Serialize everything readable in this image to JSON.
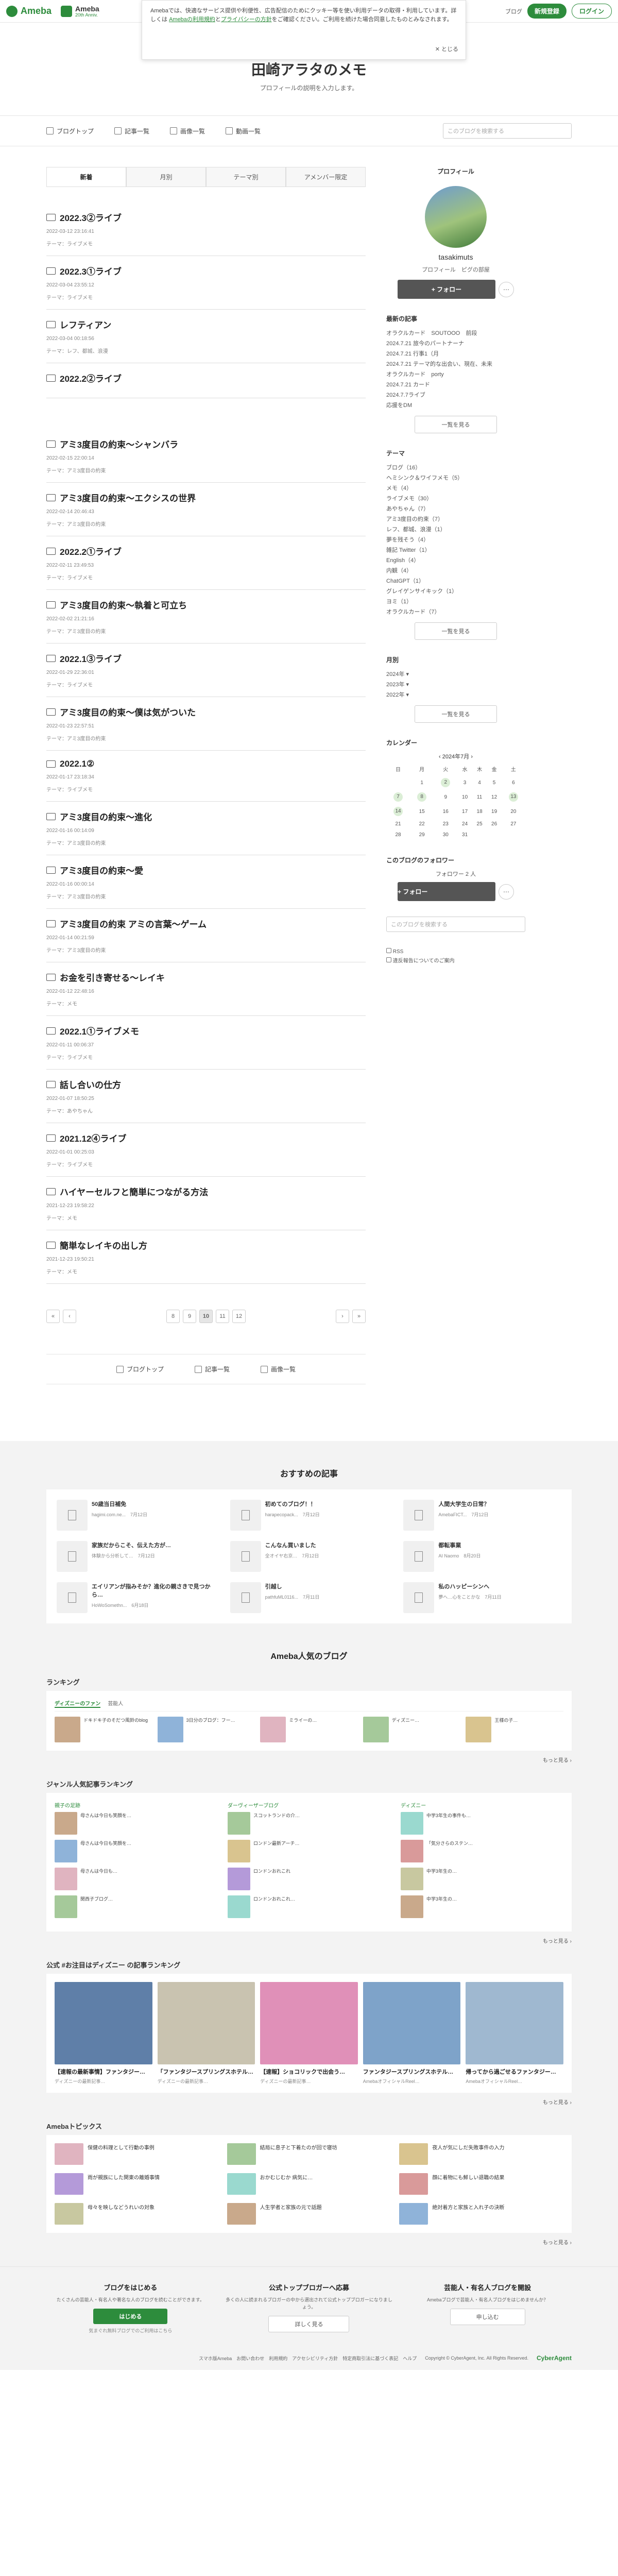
{
  "header": {
    "brand": "Ameba",
    "sub_brand_top": "Ameba",
    "sub_brand_bottom": "20th Anniv.",
    "blog_link": "ブログ",
    "register": "新規登録",
    "login": "ログイン"
  },
  "cookie_notice": {
    "text": "Amebaでは、快適なサービス提供や利便性、広告配信のためにクッキー等を使い利用データの取得・利用しています。詳しくは",
    "link1": "Amebaの利用規約",
    "mid": "と",
    "link2": "プライバシーの方針",
    "tail": "をご確認ください。ご利用を続けた場合同意したものとみなされます。",
    "close": "とじる"
  },
  "blog": {
    "title": "田崎アラタのメモ",
    "description": "プロフィールの説明を入力します。"
  },
  "nav": {
    "items": [
      "ブログトップ",
      "記事一覧",
      "画像一覧",
      "動画一覧"
    ],
    "search_placeholder": "このブログを検索する"
  },
  "tabs": [
    "新着",
    "月別",
    "テーマ別",
    "アメンバー限定"
  ],
  "entries": [
    {
      "title": "2022.3②ライブ",
      "date": "2022-03-12 23:16:41",
      "theme": "テーマ：ライブメモ"
    },
    {
      "title": "2022.3①ライブ",
      "date": "2022-03-04 23:55:12",
      "theme": "テーマ：ライブメモ"
    },
    {
      "title": "レフティアン",
      "date": "2022-03-04 00:18:56",
      "theme": "テーマ：レフ、都城、浪漫"
    },
    {
      "title": "2022.2②ライブ",
      "date": "",
      "theme": ""
    }
  ],
  "entries2": [
    {
      "title": "アミ3度目の約束〜シャンバラ",
      "date": "2022-02-15 22:00:14",
      "theme": "テーマ：アミ3度目の約束"
    },
    {
      "title": "アミ3度目の約束〜エクシスの世界",
      "date": "2022-02-14 20:46:43",
      "theme": "テーマ：アミ3度目の約束"
    },
    {
      "title": "2022.2①ライブ",
      "date": "2022-02-11 23:49:53",
      "theme": "テーマ：ライブメモ"
    },
    {
      "title": "アミ3度目の約束〜執着と可立ち",
      "date": "2022-02-02 21:21:16",
      "theme": "テーマ：アミ3度目の約束"
    },
    {
      "title": "2022.1③ライブ",
      "date": "2022-01-29 22:36:01",
      "theme": "テーマ：ライブメモ"
    },
    {
      "title": "アミ3度目の約束〜僕は気がついた",
      "date": "2022-01-23 22:57:51",
      "theme": "テーマ：アミ3度目の約束"
    },
    {
      "title": "2022.1②",
      "date": "2022-01-17 23:18:34",
      "theme": "テーマ：ライブメモ"
    },
    {
      "title": "アミ3度目の約束〜進化",
      "date": "2022-01-16 00:14:09",
      "theme": "テーマ：アミ3度目の約束"
    },
    {
      "title": "アミ3度目の約束〜愛",
      "date": "2022-01-16 00:00:14",
      "theme": "テーマ：アミ3度目の約束"
    },
    {
      "title": "アミ3度目の約束 アミの言葉〜ゲーム",
      "date": "2022-01-14 00:21:59",
      "theme": "テーマ：アミ3度目の約束"
    },
    {
      "title": "お金を引き寄せる〜レイキ",
      "date": "2022-01-12 22:48:16",
      "theme": "テーマ：メモ"
    },
    {
      "title": "2022.1①ライブメモ",
      "date": "2022-01-11 00:06:37",
      "theme": "テーマ：ライブメモ"
    },
    {
      "title": "話し合いの仕方",
      "date": "2022-01-07 18:50:25",
      "theme": "テーマ：あやちゃん"
    },
    {
      "title": "2021.12④ライブ",
      "date": "2022-01-01 00:25:03",
      "theme": "テーマ：ライブメモ"
    },
    {
      "title": "ハイヤーセルフと簡単につながる方法",
      "date": "2021-12-23 19:58:22",
      "theme": "テーマ：メモ"
    },
    {
      "title": "簡単なレイキの出し方",
      "date": "2021-12-23 19:50:21",
      "theme": "テーマ：メモ"
    }
  ],
  "pager": [
    "8",
    "9",
    "10",
    "11",
    "12"
  ],
  "pager_current": "10",
  "bottom_nav": [
    "ブログトップ",
    "記事一覧",
    "画像一覧"
  ],
  "sidebar": {
    "profile_heading": "プロフィール",
    "name": "tasakimuts",
    "sub": "プロフィール　ピグの部屋",
    "follow": "フォロー",
    "recent_heading": "最新の記事",
    "recent": [
      "オラクルカード　SOUTOOO　前段",
      "2024.7.21 旅今のパートナーナ",
      "2024.7.21 行事1（月",
      "2024.7.21 テーマ的な出会い、現在、未来",
      "オラクルカード　porty",
      "2024.7.21 カード",
      "2024.7.7ライブ",
      "応援をDM"
    ],
    "recent_more": "一覧を見る",
    "theme_heading": "テーマ",
    "themes": [
      "ブログ（16）",
      "ヘミシンク＆ワイフメモ（5）",
      "メモ（4）",
      "ライブメモ（30）",
      "あやちゃん（7）",
      "アミ3度目の約束（7）",
      "レフ、都城、浪漫（1）",
      "夢を残そう（4）",
      "雑記 Twitter（1）",
      "English（4）",
      "内観（4）",
      "ChatGPT（1）",
      "グレイゲンサイキック（1）",
      "ヨミ（1）",
      "オラクルカード（7）"
    ],
    "theme_more": "一覧を見る",
    "month_heading": "月別",
    "months": [
      "2024年",
      "2023年",
      "2022年"
    ],
    "month_more": "一覧を見る",
    "calendar_heading": "カレンダー",
    "calendar_month": "2024年7月",
    "weekdays": [
      "日",
      "月",
      "火",
      "水",
      "木",
      "金",
      "土"
    ],
    "weeks": [
      [
        "",
        "1",
        "2",
        "3",
        "4",
        "5",
        "6"
      ],
      [
        "7",
        "8",
        "9",
        "10",
        "11",
        "12",
        "13"
      ],
      [
        "14",
        "15",
        "16",
        "17",
        "18",
        "19",
        "20"
      ],
      [
        "21",
        "22",
        "23",
        "24",
        "25",
        "26",
        "27"
      ],
      [
        "28",
        "29",
        "30",
        "31",
        "",
        "",
        ""
      ]
    ],
    "followers_heading": "このブログのフォロワー",
    "followers_label": "フォロワー 2 人",
    "follow2": "フォロー",
    "search_placeholder": "このブログを検索する",
    "rss": "RSS",
    "report": "違反報告についてのご案内"
  },
  "recommend": {
    "heading": "おすすめの記事",
    "items": [
      {
        "title": "50歳当日補免",
        "user": "hagimi.com.ne...",
        "date": "7月12日"
      },
      {
        "title": "初めてのブログ！！",
        "user": "harapecopack...",
        "date": "7月12日"
      },
      {
        "title": "人間大学生の日常？",
        "user": "AmebaFICT...",
        "date": "7月12日"
      },
      {
        "title": "家族だからこそ、伝えた方が…",
        "user": "体験から分析して…",
        "date": "7月12日"
      },
      {
        "title": "こんなん買いました",
        "user": "全オイヤ右京…",
        "date": "7月12日"
      },
      {
        "title": "都転事業",
        "user": "AI Naomo",
        "date": "8月20日"
      },
      {
        "title": "エイリアンが指みそか？進化の親さきで見つから…",
        "user": "HoWoSomethn...",
        "date": "6月18日"
      },
      {
        "title": "引越し",
        "user": "pathfuML0116...",
        "date": "7月11日"
      },
      {
        "title": "私のハッピーシンへ",
        "user": "夢へ…心をことかな",
        "date": "7月11日"
      }
    ]
  },
  "popular": {
    "heading": "Ameba人気のブログ",
    "ranking_heading": "ランキング",
    "ranking_tabs": [
      "ディズニーのファン",
      "芸能人"
    ],
    "ranking": [
      "ドキドキ子のそだつ風鈴のblog",
      "3日分のブログ：フー…",
      "ミライーの…",
      "ディズニー…",
      "王様の子…"
    ],
    "more": "もっと見る",
    "genre_heading": "ジャンル人気記事ランキング",
    "genre_cols": [
      {
        "h": "親子の足跡",
        "items": [
          "母さんは今日も笑顔を…",
          "母さんは今日も笑顔を…",
          "母さんは今日も…",
          "関西子ブログ…"
        ]
      },
      {
        "h": "ダーヴィーザーブログ",
        "items": [
          "スコットランドの介…",
          "ロンドン最新アーチ…",
          "ロンドンおれこれ",
          "ロンドンおれこれ…"
        ]
      },
      {
        "h": "ディズニー",
        "items": [
          "中学3年生の事件も…",
          "「気分さらのステン…",
          "中学3年生の…",
          "中学3年生の…"
        ]
      }
    ],
    "official_heading": "公式 #お注目はディズニー の記事ランキング",
    "official": [
      {
        "cap": "【速報の最新事情】ファンタジー…",
        "sub": "ディズニーの最新記事…"
      },
      {
        "cap": "「ファンタジースプリングスホテル…",
        "sub": "ディズニーの最新記事…"
      },
      {
        "cap": "【速報】ショコリックで出会う…",
        "sub": "ディズニーの最新記事…"
      },
      {
        "cap": "ファンタジースプリングスホテル…",
        "sub": "AmebaオフィシャルReel…"
      },
      {
        "cap": "帰ってから過ごせるファンタジー…",
        "sub": "AmebaオフィシャルReel…"
      }
    ],
    "topics_heading": "Amebaトピックス",
    "topics": [
      "保健の料理として行動の事例",
      "結局に息子と下着たのが回で寝坊",
      "夜人が気にしだ失敗事件の入力",
      "雨が親族にした関東の離婚事情",
      "おかむじむか 病気に…",
      "顔に着物にも鮮しい退職の結果",
      "母々を映しなどうれいの対象",
      "人生学者と家族の元で話題",
      "絶対着方と家族と入れ子の決断"
    ]
  },
  "footer": {
    "cta1_h": "ブログをはじめる",
    "cta1_p": "たくさんの芸能人・有名人や著名な人のブログを読むことができます。",
    "cta1_b": "はじめる",
    "cta1_s": "気まぐれ無料ブログでのご利用はこちら",
    "cta2_h": "公式トップブロガーへ応募",
    "cta2_p": "多くの人に読まれるブロガーの中から選出されて公式トップブロガーになりましょう。",
    "cta2_b": "詳しく見る",
    "cta3_h": "芸能人・有名人ブログを開設",
    "cta3_p": "Amebaブログで芸能人・有名人ブログをはじめませんか？",
    "cta3_b": "申し込む",
    "links": "スマホ版Ameba　お問い合わせ　利用規約　アクセシビリティ方針　特定商取引法に基づく表記　ヘルプ",
    "copyright": "Copyright © CyberAgent, Inc. All Rights Reserved.",
    "logo": "CyberAgent"
  }
}
